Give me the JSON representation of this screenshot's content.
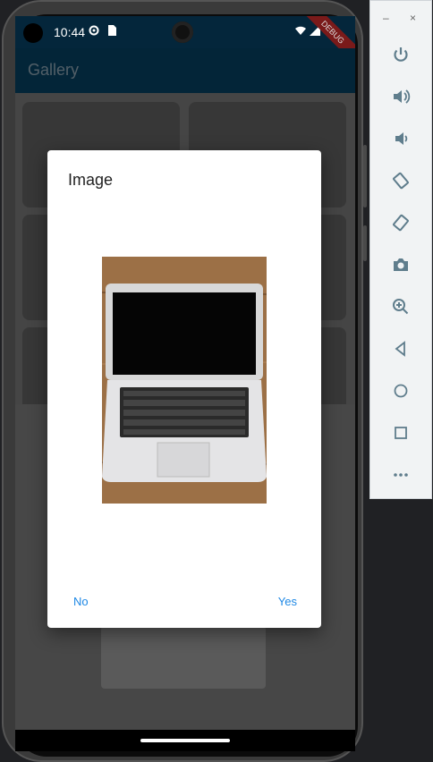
{
  "status_bar": {
    "time": "10:44",
    "debug_label": "DEBUG"
  },
  "app": {
    "title": "Gallery"
  },
  "dialog": {
    "title": "Image",
    "image_icon": "laptop-photo",
    "buttons": {
      "no": "No",
      "yes": "Yes"
    }
  },
  "emulator_toolbar": {
    "window_controls": {
      "minimize": "–",
      "close": "×"
    },
    "tools": [
      {
        "name": "power",
        "icon": "power-icon"
      },
      {
        "name": "volume-up",
        "icon": "volume-up-icon"
      },
      {
        "name": "volume-down",
        "icon": "volume-down-icon"
      },
      {
        "name": "rotate-left",
        "icon": "rotate-left-icon"
      },
      {
        "name": "rotate-right",
        "icon": "rotate-right-icon"
      },
      {
        "name": "screenshot",
        "icon": "camera-icon"
      },
      {
        "name": "zoom",
        "icon": "zoom-icon"
      },
      {
        "name": "back",
        "icon": "back-icon"
      },
      {
        "name": "home",
        "icon": "home-icon"
      },
      {
        "name": "overview",
        "icon": "overview-icon"
      },
      {
        "name": "more",
        "icon": "more-icon"
      }
    ]
  },
  "colors": {
    "status_bar": "#04263b",
    "app_bar": "#053a56",
    "accent": "#1e88e5",
    "toolbar_icon": "#5f7d8c"
  }
}
